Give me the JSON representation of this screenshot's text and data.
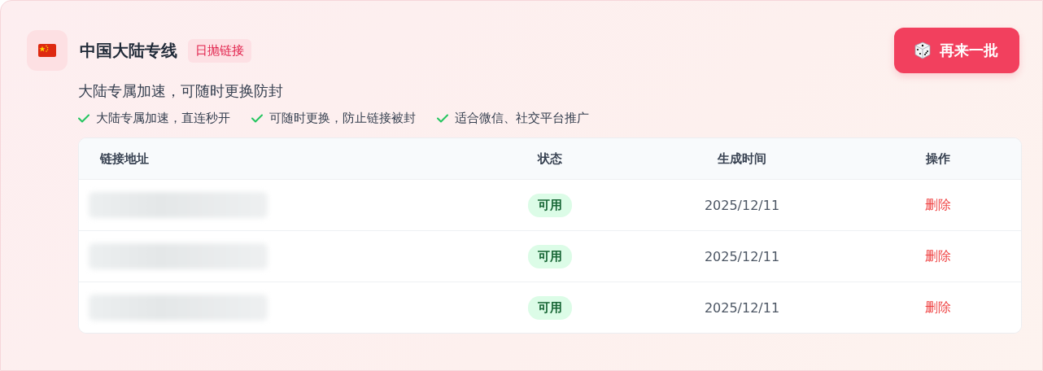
{
  "header": {
    "title": "中国大陆专线",
    "badge": "日抛链接",
    "button": "再来一批"
  },
  "subtitle": "大陆专属加速，可随时更换防封",
  "features": [
    {
      "text": "大陆专属加速，直连秒开"
    },
    {
      "text": "可随时更换，防止链接被封"
    },
    {
      "text": "适合微信、社交平台推广"
    }
  ],
  "table": {
    "columns": [
      "链接地址",
      "状态",
      "生成时间",
      "操作"
    ],
    "rows": [
      {
        "link_redacted": true,
        "status": "可用",
        "time": "2025/12/11",
        "action": "删除"
      },
      {
        "link_redacted": true,
        "status": "可用",
        "time": "2025/12/11",
        "action": "删除"
      },
      {
        "link_redacted": true,
        "status": "可用",
        "time": "2025/12/11",
        "action": "删除"
      }
    ]
  }
}
